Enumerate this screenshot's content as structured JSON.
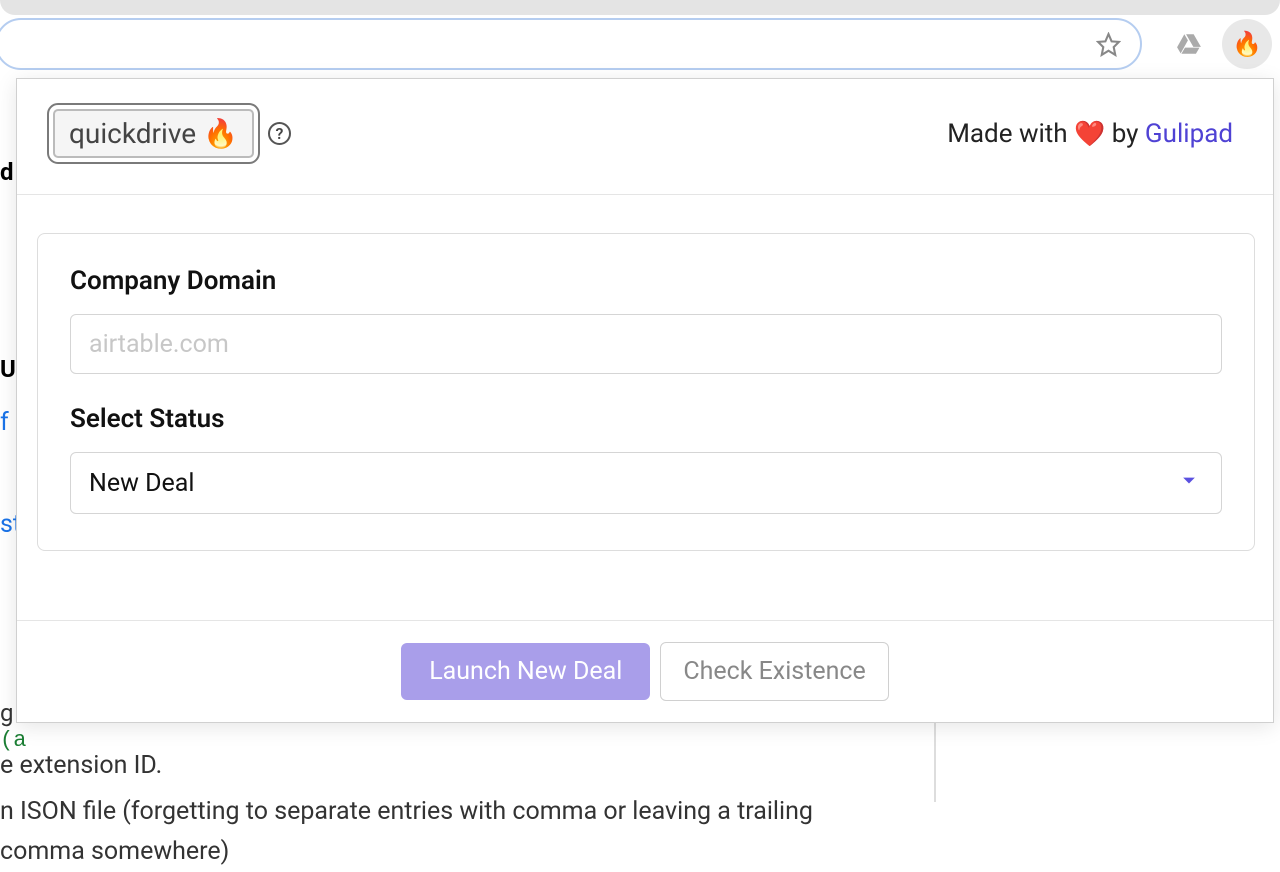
{
  "chrome": {
    "extension_avatar_emoji": "🔥"
  },
  "popup": {
    "brand": {
      "name": "quickdrive",
      "emoji": "🔥"
    },
    "made_with_prefix": "Made with",
    "made_with_heart": "❤️",
    "made_with_by": "  by ",
    "author": "Gulipad",
    "form": {
      "company_domain": {
        "label": "Company Domain",
        "placeholder": "airtable.com",
        "value": ""
      },
      "select_status": {
        "label": "Select Status",
        "selected": "New Deal"
      }
    },
    "actions": {
      "primary": "Launch New Deal",
      "secondary": "Check Existence"
    }
  },
  "background_fragments": {
    "d": "d",
    "u": "U",
    "f": "f",
    "st": "st",
    "g": "g",
    "paren": "(a",
    "ext": "e extension ID.",
    "json": "n ISON file (forgetting to separate entries with comma or leaving a trailing comma somewhere)"
  }
}
